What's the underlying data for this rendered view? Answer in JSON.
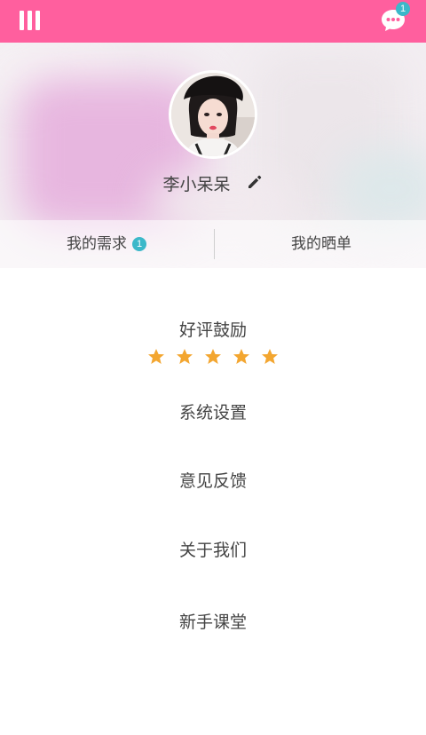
{
  "topbar": {
    "background": "#ff5f9e",
    "menu_icon": "menu-icon",
    "message_icon": "chat-bubble-icon",
    "message_badge": "1"
  },
  "profile": {
    "username": "李小呆呆",
    "avatar": "avatar-photo",
    "edit_icon": "pencil-icon"
  },
  "tabs": [
    {
      "label": "我的需求",
      "badge": "1"
    },
    {
      "label": "我的晒单"
    }
  ],
  "rating": {
    "label": "好评鼓励",
    "stars": 5,
    "star_color": "#f3a630"
  },
  "menu": [
    {
      "label": "系统设置"
    },
    {
      "label": "意见反馈"
    },
    {
      "label": "关于我们"
    },
    {
      "label": "新手课堂"
    }
  ],
  "colors": {
    "accent": "#ff5f9e",
    "badge": "#3bb8c9",
    "text": "#444444"
  }
}
